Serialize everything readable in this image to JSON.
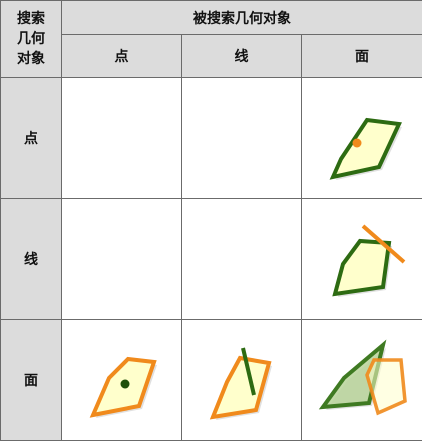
{
  "corner": {
    "line1": "搜索",
    "line2": "几何",
    "line3": "对象"
  },
  "header": {
    "title": "被搜索几何对象"
  },
  "columns": [
    "点",
    "线",
    "面"
  ],
  "rows": [
    "点",
    "线",
    "面"
  ],
  "colors": {
    "polygon_fill": "#ffffcc",
    "green_edge": "#2d6b12",
    "orange_edge": "#f08a1c",
    "header_bg": "#dcdcdc",
    "grid_line": "#6b6b6b"
  }
}
